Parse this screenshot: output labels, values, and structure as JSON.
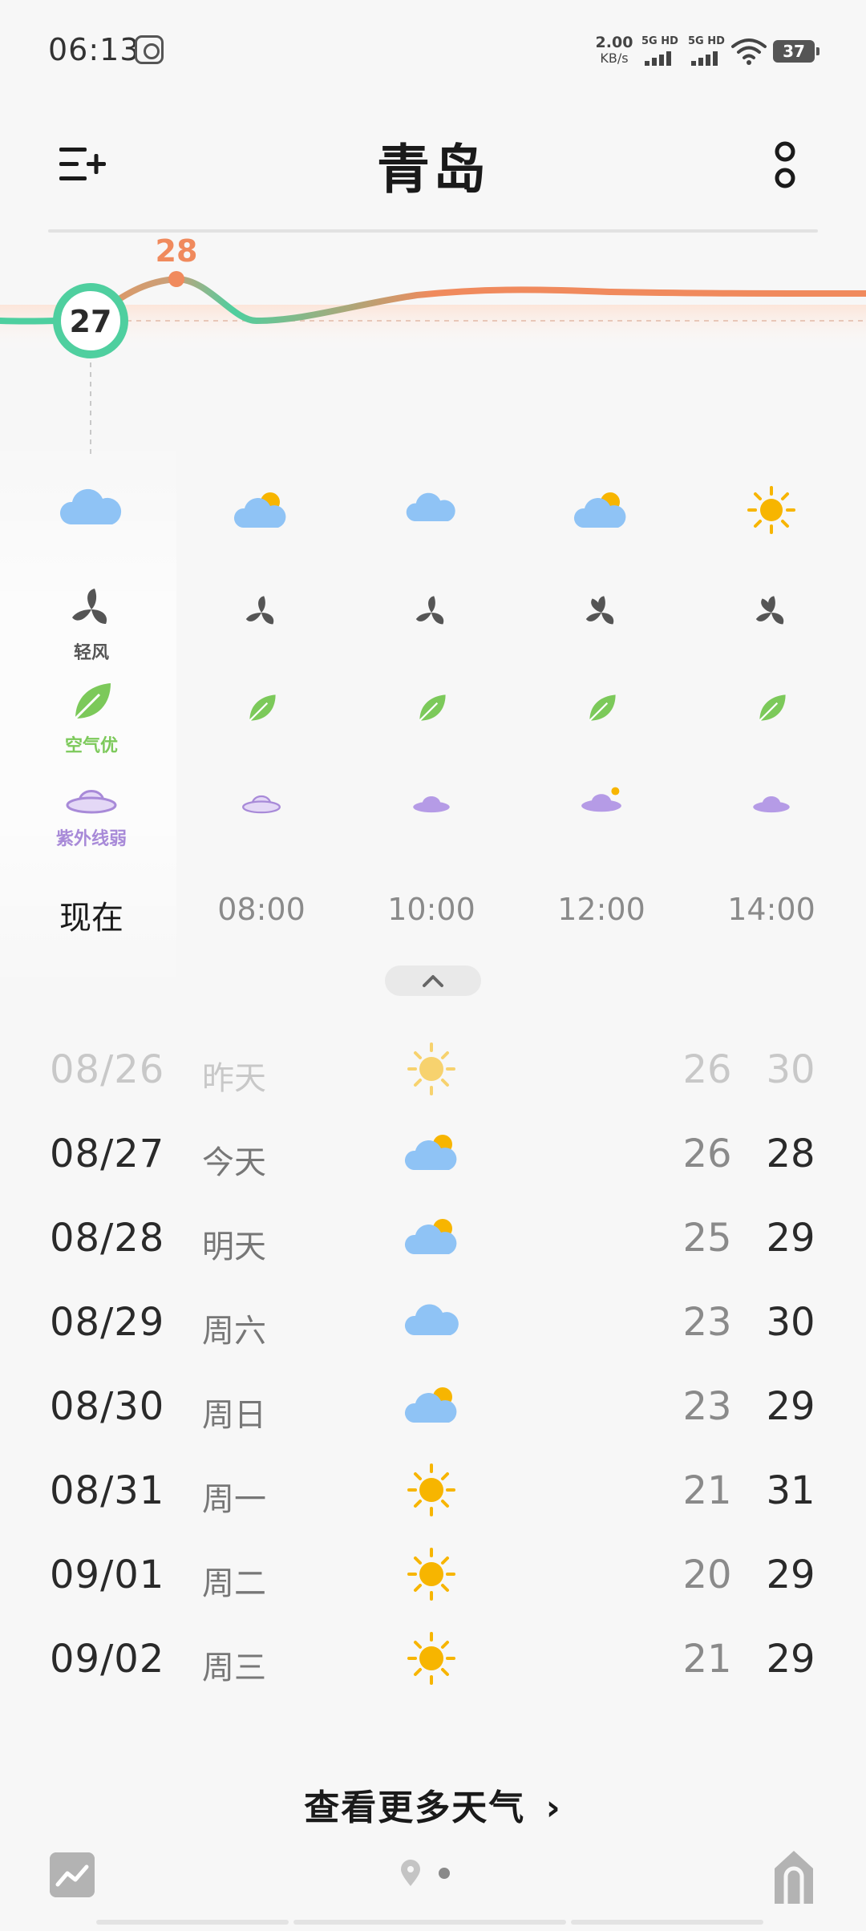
{
  "status_bar": {
    "time": "06:13",
    "net_speed": "2.00",
    "net_unit": "KB/s",
    "sim1": "5G HD",
    "sim2": "5G HD",
    "battery": "37"
  },
  "header": {
    "city": "青岛"
  },
  "colors": {
    "current_temp_ring": "#4fcf9f",
    "high_temp_line": "#f08a5d",
    "air_good": "#7cc95a",
    "uv": "#a88ad8",
    "cloud": "#8fc3f5",
    "sun": "#f7b500"
  },
  "current": {
    "temp": "27",
    "peak_temp": "28"
  },
  "hourly": [
    {
      "time": "现在",
      "weather_icon": "cloudy-icon",
      "wind_label": "轻风",
      "air_label": "空气优",
      "uv_label": "紫外线弱"
    },
    {
      "time": "08:00",
      "weather_icon": "partly-cloudy-icon"
    },
    {
      "time": "10:00",
      "weather_icon": "cloudy-icon"
    },
    {
      "time": "12:00",
      "weather_icon": "partly-cloudy-icon"
    },
    {
      "time": "14:00",
      "weather_icon": "sunny-icon"
    }
  ],
  "daily": [
    {
      "date": "08/26",
      "name": "昨天",
      "icon": "sunny-icon",
      "low": "26",
      "high": "30"
    },
    {
      "date": "08/27",
      "name": "今天",
      "icon": "partly-cloudy-icon",
      "low": "26",
      "high": "28"
    },
    {
      "date": "08/28",
      "name": "明天",
      "icon": "partly-cloudy-icon",
      "low": "25",
      "high": "29"
    },
    {
      "date": "08/29",
      "name": "周六",
      "icon": "cloudy-icon",
      "low": "23",
      "high": "30"
    },
    {
      "date": "08/30",
      "name": "周日",
      "icon": "partly-cloudy-icon",
      "low": "23",
      "high": "29"
    },
    {
      "date": "08/31",
      "name": "周一",
      "icon": "sunny-icon",
      "low": "21",
      "high": "31"
    },
    {
      "date": "09/01",
      "name": "周二",
      "icon": "sunny-icon",
      "low": "20",
      "high": "29"
    },
    {
      "date": "09/02",
      "name": "周三",
      "icon": "sunny-icon",
      "low": "21",
      "high": "29"
    }
  ],
  "more_weather": "查看更多天气",
  "more_weather_arrow": "›"
}
